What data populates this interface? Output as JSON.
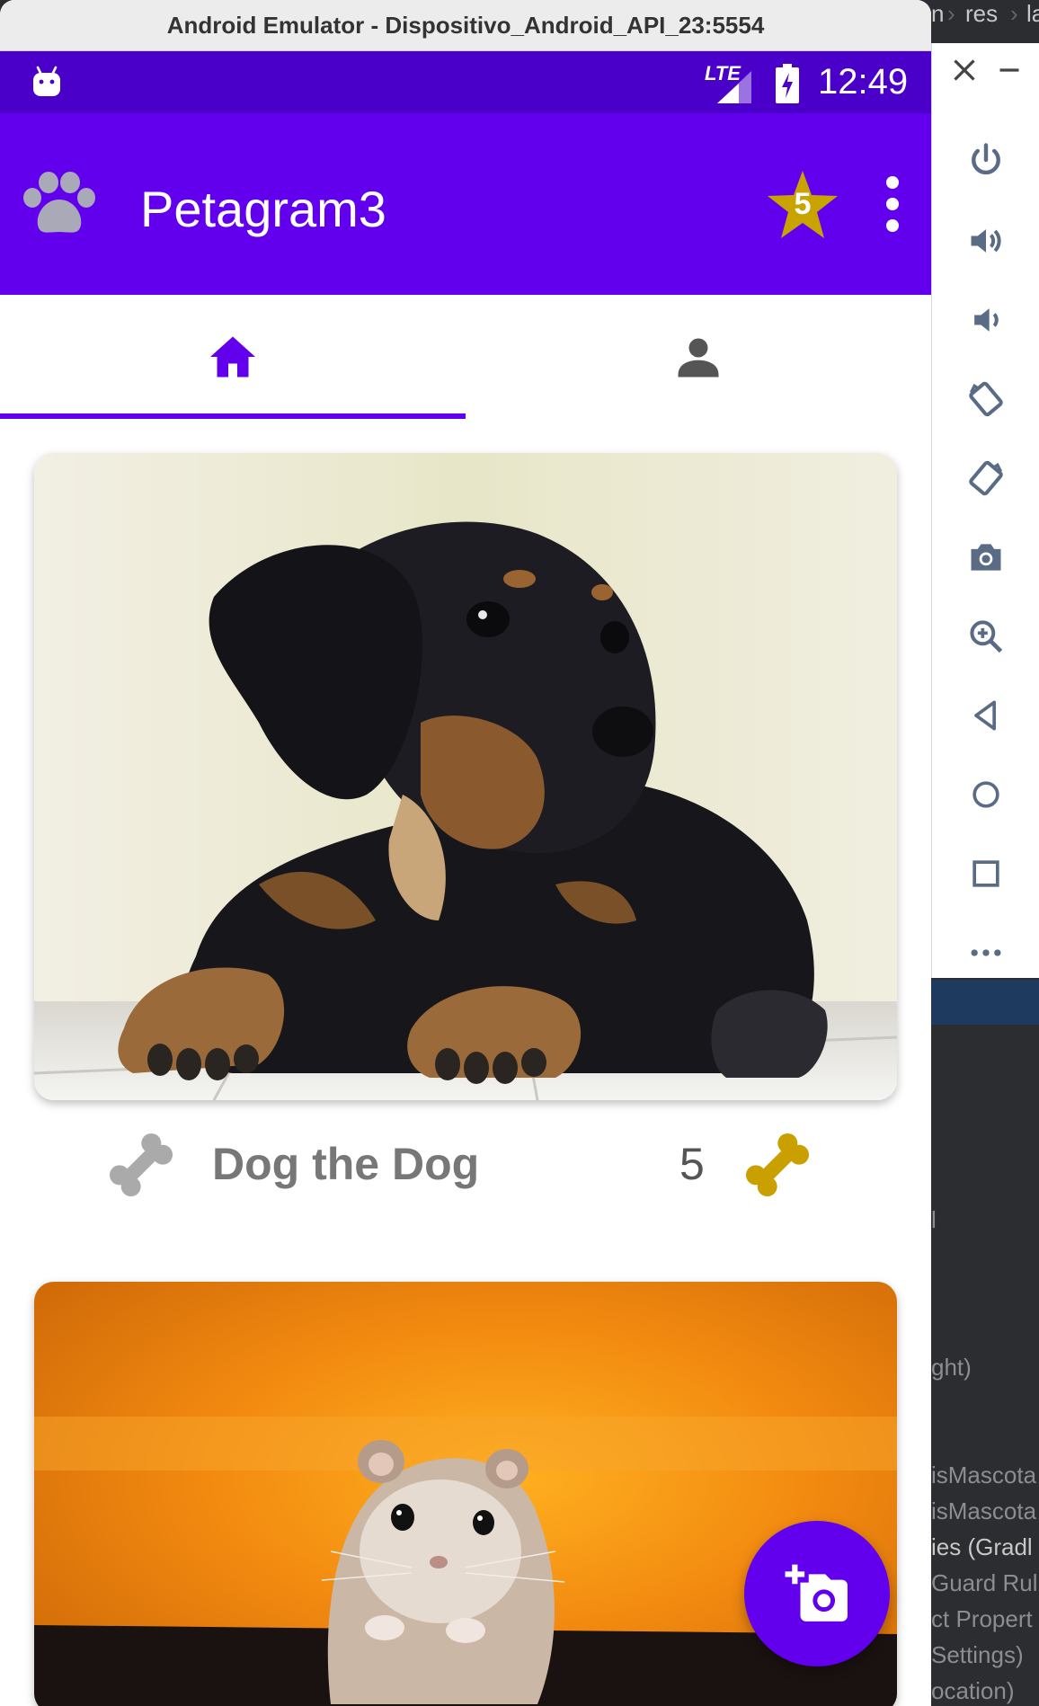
{
  "emulator": {
    "window_title": "Android Emulator - Dispositivo_Android_API_23:5554"
  },
  "status_bar": {
    "network": "LTE",
    "time": "12:49"
  },
  "app_bar": {
    "title": "Petagram3",
    "favorites_count": "5",
    "logo_icon": "paw-icon",
    "favorites_icon": "star-icon",
    "menu_icon": "more-vert-icon"
  },
  "tabs": [
    {
      "icon": "home-icon",
      "selected": true
    },
    {
      "icon": "person-icon",
      "selected": false
    }
  ],
  "pets": [
    {
      "name": "Dog the Dog",
      "likes": "5",
      "image": "dachshund-puppy"
    },
    {
      "image": "hamster"
    }
  ],
  "fab": {
    "icon": "add-a-photo-icon"
  },
  "emulator_toolbar": [
    "close-icon",
    "minimize-icon",
    "power-icon",
    "volume-up-icon",
    "volume-down-icon",
    "rotate-left-icon",
    "rotate-right-icon",
    "camera-icon",
    "zoom-icon",
    "back-icon",
    "home-icon",
    "overview-icon",
    "more-icon"
  ],
  "ide_background": {
    "breadcrumb": [
      "n",
      "res",
      "la"
    ],
    "lines": [
      "l",
      "ght)",
      "isMascota",
      "isMascota",
      "ies (Gradl",
      "Guard Rul",
      "ct Propert",
      "Settings)",
      "ocation)"
    ]
  },
  "colors": {
    "primary": "#6200ee",
    "status_bar": "#4a00c8",
    "star_gold": "#c9a400",
    "bone_gold": "#c9a000",
    "bone_gray": "#aaaaaa"
  }
}
